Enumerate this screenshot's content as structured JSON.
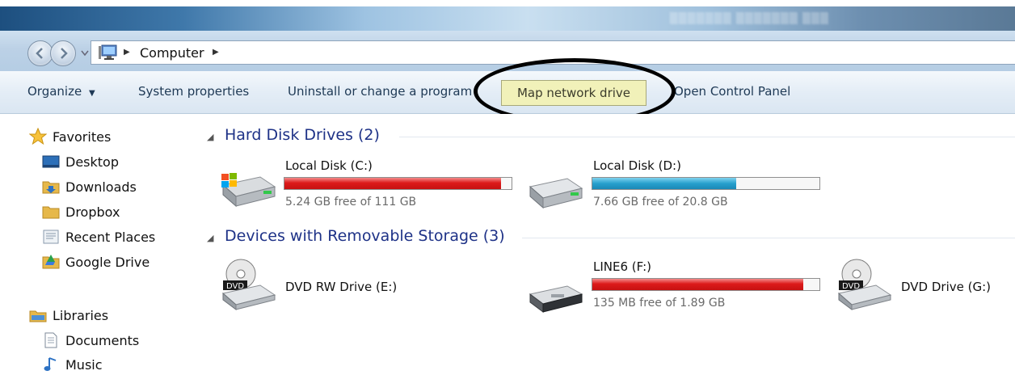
{
  "address": {
    "breadcrumb": "Computer"
  },
  "toolbar": {
    "organize": "Organize",
    "system_properties": "System properties",
    "uninstall": "Uninstall or change a program",
    "map_network_drive": "Map network drive",
    "open_control_panel": "Open Control Panel"
  },
  "nav": {
    "favorites": "Favorites",
    "items": [
      "Desktop",
      "Downloads",
      "Dropbox",
      "Recent Places",
      "Google Drive"
    ],
    "libraries": "Libraries",
    "library_items": [
      "Documents",
      "Music"
    ]
  },
  "groups": {
    "hard_disks": {
      "title": "Hard Disk Drives (2)"
    },
    "removable": {
      "title": "Devices with Removable Storage (3)"
    }
  },
  "drives": {
    "c": {
      "name": "Local Disk (C:)",
      "free": "5.24 GB free of 111 GB",
      "used_fraction": 0.953,
      "bar_color": "#dc1a1a"
    },
    "d": {
      "name": "Local Disk (D:)",
      "free": "7.66 GB free of 20.8 GB",
      "used_fraction": 0.632,
      "bar_color": "#27a0cd"
    },
    "e": {
      "name": "DVD RW Drive (E:)",
      "label": "DVD"
    },
    "f": {
      "name": "LINE6 (F:)",
      "free": "135 MB free of 1.89 GB",
      "used_fraction": 0.93,
      "bar_color": "#dc1a1a"
    },
    "g": {
      "name": "DVD Drive (G:)",
      "label": "DVD"
    }
  }
}
